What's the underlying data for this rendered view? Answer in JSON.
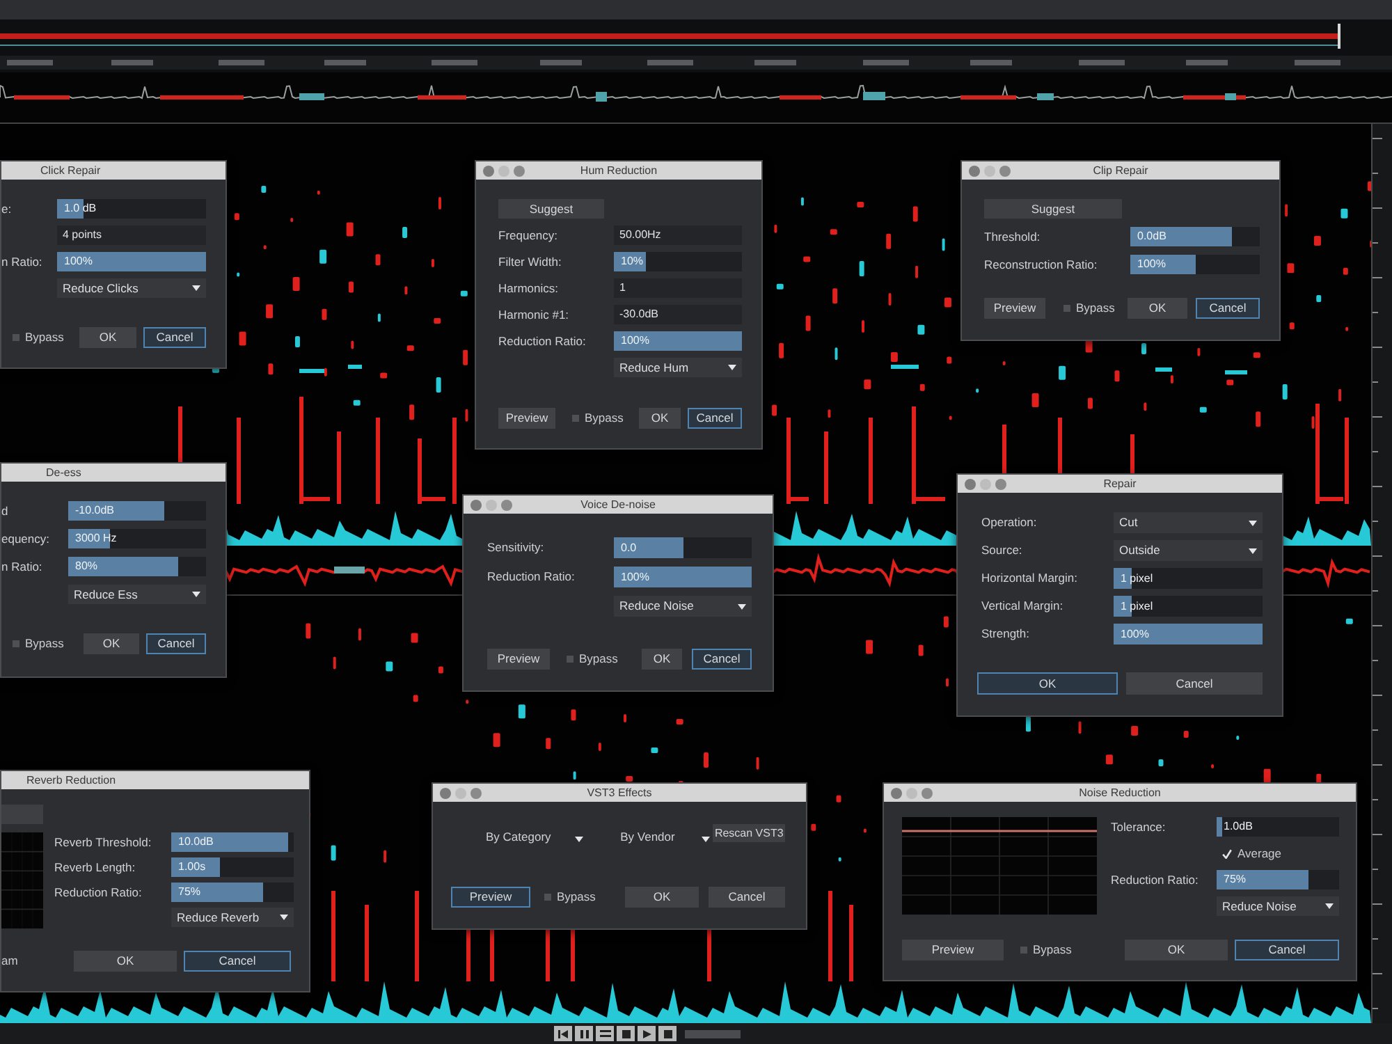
{
  "dialogs": [
    {
      "kind": "form",
      "title": "Click Repair",
      "rows": [
        {
          "kind": "slider",
          "label": "e:",
          "value": "1.0 dB",
          "level": 0.18
        },
        {
          "kind": "field",
          "value": "4 points"
        },
        {
          "kind": "slider",
          "label": "n Ratio:",
          "value": "100%",
          "level": 1
        },
        {
          "kind": "dropdown",
          "value": "Reduce Clicks"
        }
      ],
      "footer": [
        {
          "kind": "checkbox",
          "label": "Bypass",
          "checked": false
        },
        {
          "kind": "button",
          "label": "OK",
          "focused": false
        },
        {
          "kind": "button",
          "label": "Cancel",
          "focused": true
        }
      ]
    },
    {
      "kind": "form",
      "title": "Hum Reduction",
      "rows": [
        {
          "kind": "button",
          "label": "Suggest"
        },
        {
          "kind": "field",
          "label": "Frequency:",
          "value": "50.00Hz"
        },
        {
          "kind": "slider",
          "label": "Filter Width:",
          "value": "10%",
          "level": 0.25
        },
        {
          "kind": "field",
          "label": "Harmonics:",
          "value": "1"
        },
        {
          "kind": "field",
          "label": "Harmonic #1:",
          "value": "-30.0dB"
        },
        {
          "kind": "slider",
          "label": "Reduction Ratio:",
          "value": "100%",
          "level": 1
        },
        {
          "kind": "dropdown",
          "value": "Reduce Hum"
        }
      ],
      "footer": [
        {
          "kind": "button",
          "label": "Preview",
          "focused": false
        },
        {
          "kind": "checkbox",
          "label": "Bypass",
          "checked": false
        },
        {
          "kind": "button",
          "label": "OK",
          "focused": false
        },
        {
          "kind": "button",
          "label": "Cancel",
          "focused": true
        }
      ]
    },
    {
      "kind": "form",
      "title": "Clip Repair",
      "rows": [
        {
          "kind": "button",
          "label": "Suggest"
        },
        {
          "kind": "slider",
          "label": "Threshold:",
          "value": "0.0dB",
          "level": 0.78
        },
        {
          "kind": "slider",
          "label": "Reconstruction Ratio:",
          "value": "100%",
          "level": 0.5
        }
      ],
      "footer": [
        {
          "kind": "button",
          "label": "Preview",
          "focused": false
        },
        {
          "kind": "checkbox",
          "label": "Bypass",
          "checked": false
        },
        {
          "kind": "button",
          "label": "OK",
          "focused": false
        },
        {
          "kind": "button",
          "label": "Cancel",
          "focused": true
        }
      ]
    },
    {
      "kind": "form",
      "title": "De-ess",
      "rows": [
        {
          "kind": "slider",
          "label": "d",
          "value": "-10.0dB",
          "level": 0.7
        },
        {
          "kind": "slider",
          "label": "equency:",
          "value": "3000 Hz",
          "level": 0.3
        },
        {
          "kind": "slider",
          "label": "n Ratio:",
          "value": "80%",
          "level": 0.8
        },
        {
          "kind": "dropdown",
          "value": "Reduce Ess"
        }
      ],
      "footer": [
        {
          "kind": "checkbox",
          "label": "Bypass",
          "checked": false
        },
        {
          "kind": "button",
          "label": "OK",
          "focused": false
        },
        {
          "kind": "button",
          "label": "Cancel",
          "focused": true
        }
      ]
    },
    {
      "kind": "form",
      "title": "Voice De-noise",
      "rows": [
        {
          "kind": "slider",
          "label": "Sensitivity:",
          "value": "0.0",
          "level": 0.5
        },
        {
          "kind": "slider",
          "label": "Reduction Ratio:",
          "value": "100%",
          "level": 1
        },
        {
          "kind": "dropdown",
          "value": "Reduce Noise"
        }
      ],
      "footer": [
        {
          "kind": "button",
          "label": "Preview",
          "focused": false
        },
        {
          "kind": "checkbox",
          "label": "Bypass",
          "checked": false
        },
        {
          "kind": "button",
          "label": "OK",
          "focused": false
        },
        {
          "kind": "button",
          "label": "Cancel",
          "focused": true
        }
      ]
    },
    {
      "kind": "form",
      "title": "Repair",
      "rows": [
        {
          "kind": "dropdown",
          "label": "Operation:",
          "value": "Cut"
        },
        {
          "kind": "dropdown",
          "label": "Source:",
          "value": "Outside"
        },
        {
          "kind": "slider",
          "label": "Horizontal Margin:",
          "value": "1 pixel",
          "level": 0.12
        },
        {
          "kind": "slider",
          "label": "Vertical Margin:",
          "value": "1 pixel",
          "level": 0.12
        },
        {
          "kind": "slider",
          "label": "Strength:",
          "value": "100%",
          "level": 1
        }
      ],
      "footer": [
        {
          "kind": "button",
          "label": "OK",
          "focused": true
        },
        {
          "kind": "button",
          "label": "Cancel",
          "focused": false
        }
      ]
    },
    {
      "kind": "graph",
      "title": "Reverb Reduction",
      "rows": [
        {
          "kind": "slider",
          "label": "Reverb Threshold:",
          "value": "10.0dB",
          "level": 0.95
        },
        {
          "kind": "slider",
          "label": "Reverb Length:",
          "value": "1.00s",
          "level": 0.4
        },
        {
          "kind": "slider",
          "label": "Reduction Ratio:",
          "value": "75%",
          "level": 0.75
        },
        {
          "kind": "dropdown",
          "value": "Reduce Reverb"
        }
      ],
      "footer": [
        {
          "kind": "label",
          "label": "am"
        },
        {
          "kind": "button",
          "label": "OK",
          "focused": false
        },
        {
          "kind": "button",
          "label": "Cancel",
          "focused": true
        }
      ]
    },
    {
      "kind": "browser",
      "title": "VST3 Effects",
      "rows": [
        {
          "kind": "filter",
          "label": "By Category"
        },
        {
          "kind": "filter",
          "label": "By Vendor"
        },
        {
          "kind": "button",
          "label": "Rescan VST3"
        }
      ],
      "footer": [
        {
          "kind": "button",
          "label": "Preview",
          "focused": true
        },
        {
          "kind": "checkbox",
          "label": "Bypass",
          "checked": false
        },
        {
          "kind": "button",
          "label": "OK",
          "focused": false
        },
        {
          "kind": "button",
          "label": "Cancel",
          "focused": false
        }
      ]
    },
    {
      "kind": "graph",
      "title": "Noise Reduction",
      "rows": [
        {
          "kind": "slider",
          "label": "Tolerance:",
          "value": "1.0dB",
          "level": 0.05
        },
        {
          "kind": "checkbox",
          "label": "Average",
          "checked": true
        },
        {
          "kind": "slider",
          "label": "Reduction Ratio:",
          "value": "75%",
          "level": 0.75
        },
        {
          "kind": "dropdown",
          "value": "Reduce Noise"
        }
      ],
      "footer": [
        {
          "kind": "button",
          "label": "Preview",
          "focused": false
        },
        {
          "kind": "checkbox",
          "label": "Bypass",
          "checked": false
        },
        {
          "kind": "button",
          "label": "OK",
          "focused": false
        },
        {
          "kind": "button",
          "label": "Cancel",
          "focused": true
        }
      ]
    }
  ]
}
